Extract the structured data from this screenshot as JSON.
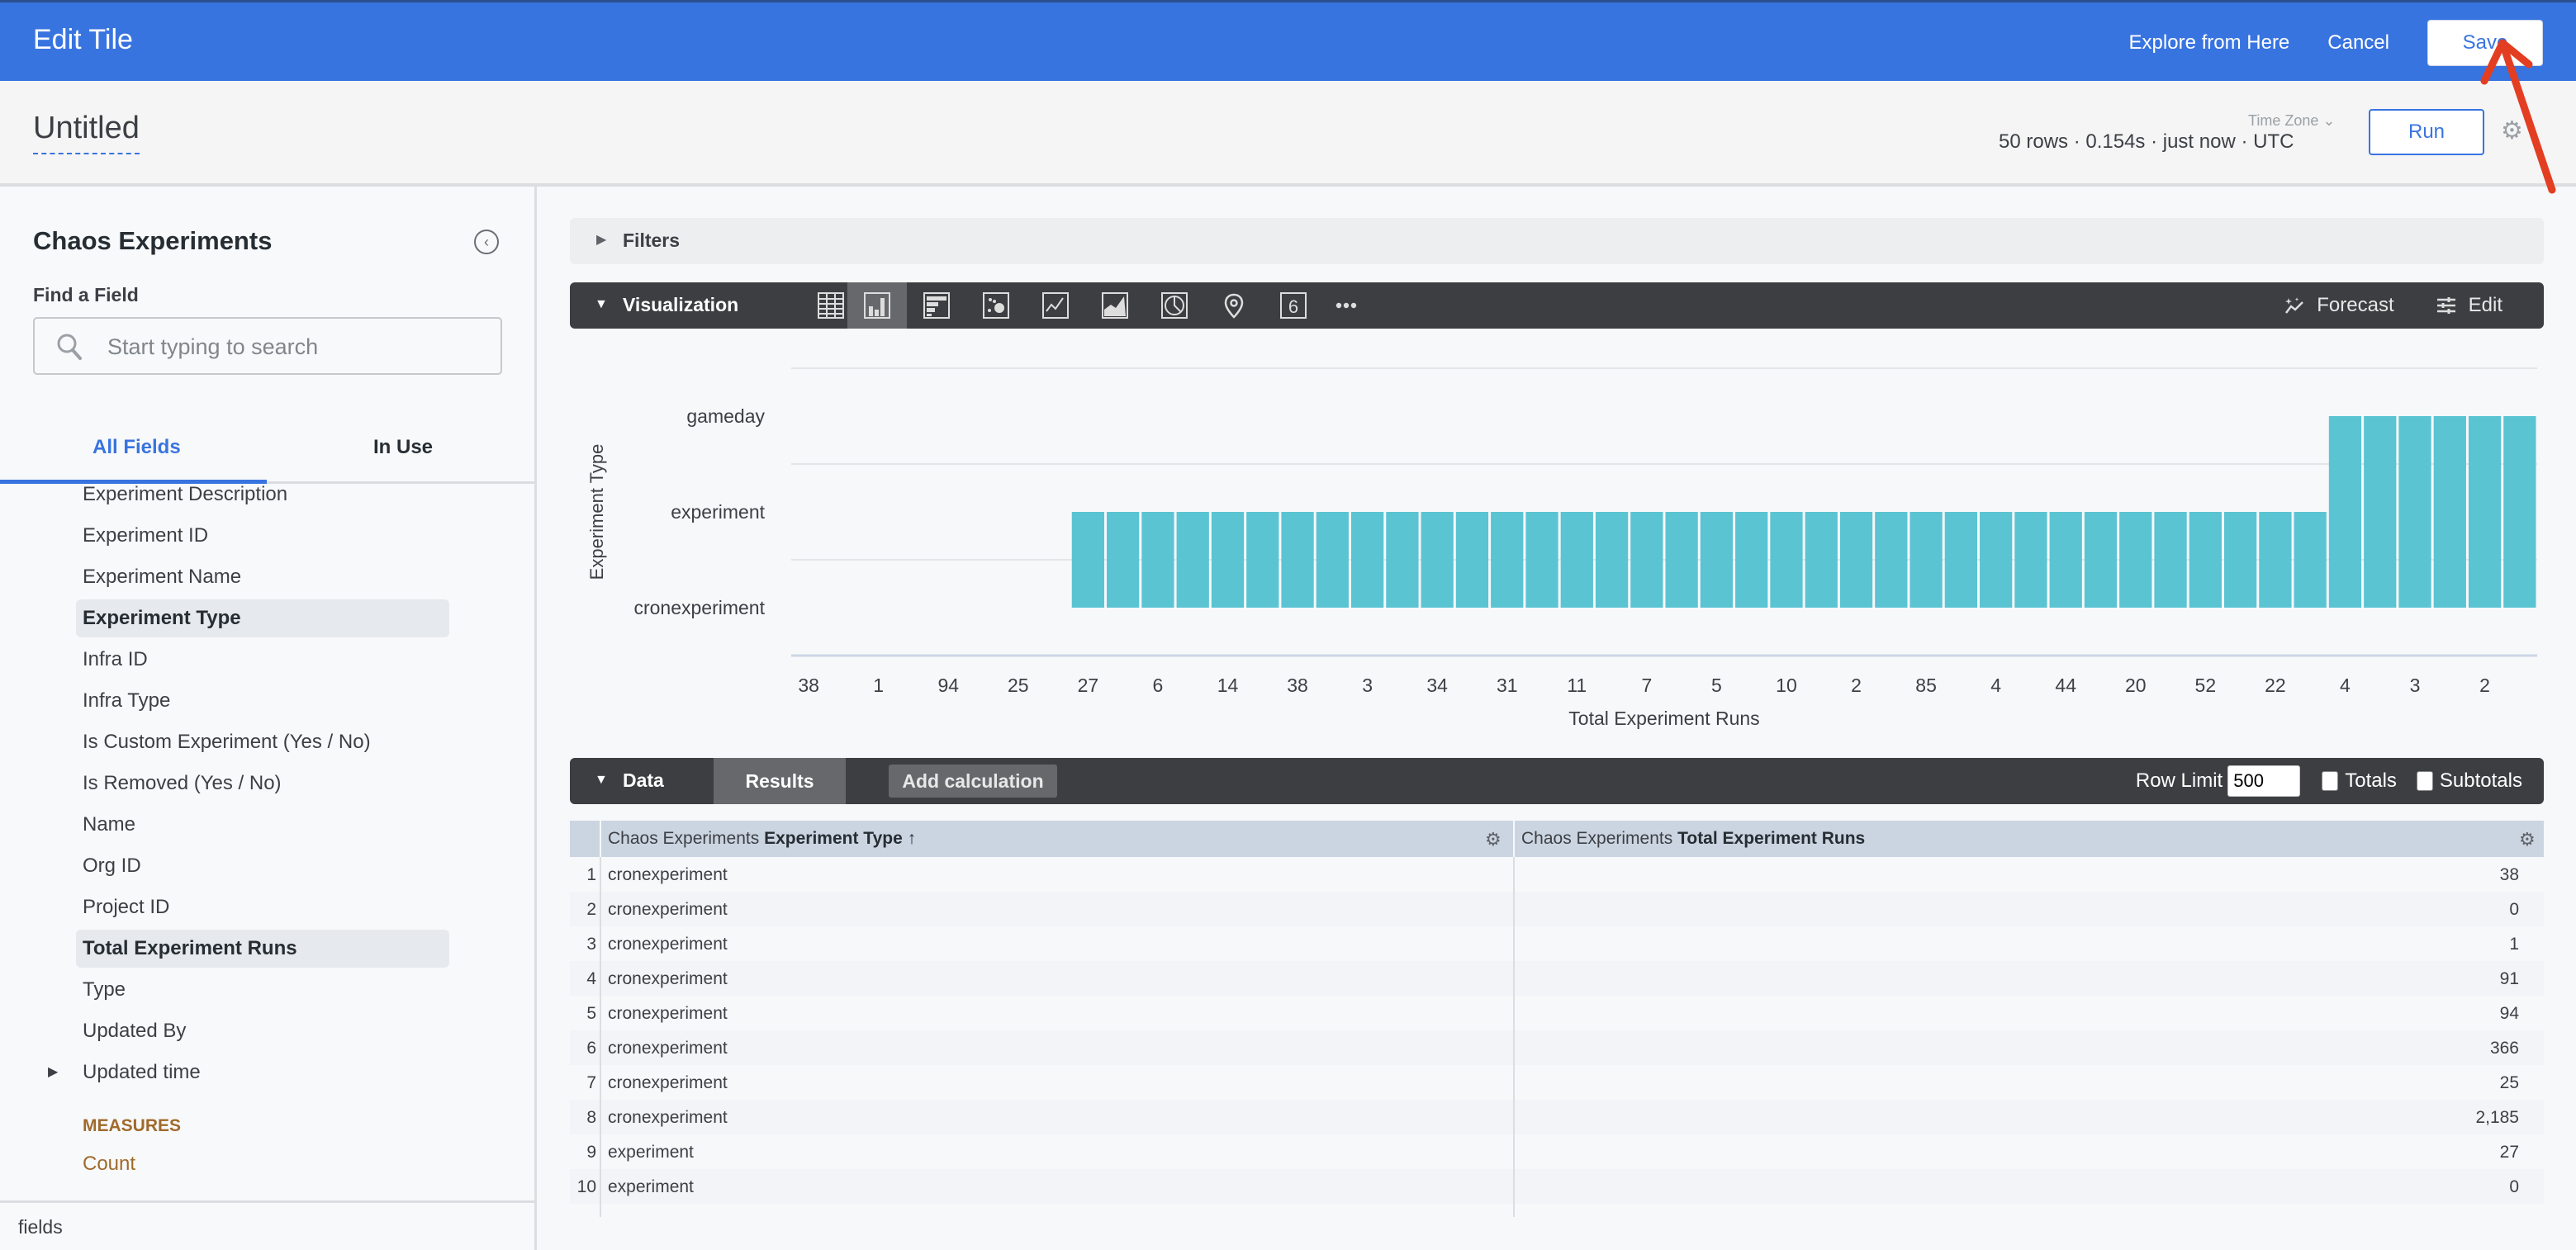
{
  "header": {
    "title": "Edit Tile",
    "explore_label": "Explore from Here",
    "cancel_label": "Cancel",
    "save_label": "Save"
  },
  "subheader": {
    "tile_title": "Untitled",
    "status": "50 rows · 0.154s · just now · UTC",
    "timezone_label": "Time Zone",
    "run_label": "Run"
  },
  "sidebar": {
    "explore_name": "Chaos Experiments",
    "find_label": "Find a Field",
    "search_placeholder": "Start typing to search",
    "tabs": [
      {
        "label": "All Fields",
        "active": true
      },
      {
        "label": "In Use",
        "active": false
      }
    ],
    "fields": [
      {
        "label": "Experiment Description",
        "selected": false
      },
      {
        "label": "Experiment ID",
        "selected": false
      },
      {
        "label": "Experiment Name",
        "selected": false
      },
      {
        "label": "Experiment Type",
        "selected": true
      },
      {
        "label": "Infra ID",
        "selected": false
      },
      {
        "label": "Infra Type",
        "selected": false
      },
      {
        "label": "Is Custom Experiment (Yes / No)",
        "selected": false
      },
      {
        "label": "Is Removed (Yes / No)",
        "selected": false
      },
      {
        "label": "Name",
        "selected": false
      },
      {
        "label": "Org ID",
        "selected": false
      },
      {
        "label": "Project ID",
        "selected": false
      },
      {
        "label": "Total Experiment Runs",
        "selected": true
      },
      {
        "label": "Type",
        "selected": false
      },
      {
        "label": "Updated By",
        "selected": false
      },
      {
        "label": "Updated time",
        "selected": false,
        "expandable": true
      }
    ],
    "measures_title": "MEASURES",
    "measures": [
      "Count"
    ],
    "footer": "fields"
  },
  "filters": {
    "label": "Filters"
  },
  "visualization": {
    "label": "Visualization",
    "types": [
      "table-icon",
      "column-chart-icon",
      "bar-chart-icon",
      "scatter-icon",
      "line-chart-icon",
      "area-chart-icon",
      "pie-chart-icon",
      "map-pin-icon",
      "single-value-icon",
      "more-icon"
    ],
    "active_type": "column-chart-icon",
    "forecast_label": "Forecast",
    "edit_label": "Edit"
  },
  "chart_data": {
    "type": "bar",
    "title": "",
    "xlabel": "Total Experiment Runs",
    "ylabel": "Experiment Type",
    "y_categories": [
      "cronexperiment",
      "experiment",
      "gameday"
    ],
    "x_tick_labels": [
      "38",
      "1",
      "94",
      "25",
      "27",
      "6",
      "14",
      "38",
      "3",
      "34",
      "31",
      "11",
      "7",
      "5",
      "10",
      "2",
      "85",
      "4",
      "44",
      "20",
      "52",
      "22",
      "4",
      "3",
      "2"
    ],
    "bar_count": 50,
    "series": [
      {
        "name": "Experiment Type",
        "values": [
          0,
          0,
          0,
          0,
          0,
          0,
          0,
          0,
          1,
          1,
          1,
          1,
          1,
          1,
          1,
          1,
          1,
          1,
          1,
          1,
          1,
          1,
          1,
          1,
          1,
          1,
          1,
          1,
          1,
          1,
          1,
          1,
          1,
          1,
          1,
          1,
          1,
          1,
          1,
          1,
          1,
          1,
          1,
          1,
          2,
          2,
          2,
          2,
          2,
          2
        ]
      }
    ],
    "value_meaning": "index into y_categories (0=cronexperiment, 1=experiment, 2=gameday)",
    "bar_color": "#5bc4d2",
    "grid": true
  },
  "data": {
    "label": "Data",
    "results_label": "Results",
    "add_calc_label": "Add calculation",
    "row_limit_label": "Row Limit",
    "row_limit": "500",
    "totals_label": "Totals",
    "subtotals_label": "Subtotals",
    "columns": [
      {
        "prefix": "Chaos Experiments",
        "name": "Experiment Type",
        "sort": "↑"
      },
      {
        "prefix": "Chaos Experiments",
        "name": "Total Experiment Runs",
        "sort": ""
      }
    ],
    "rows": [
      {
        "n": "1",
        "type": "cronexperiment",
        "value": "38"
      },
      {
        "n": "2",
        "type": "cronexperiment",
        "value": "0"
      },
      {
        "n": "3",
        "type": "cronexperiment",
        "value": "1"
      },
      {
        "n": "4",
        "type": "cronexperiment",
        "value": "91"
      },
      {
        "n": "5",
        "type": "cronexperiment",
        "value": "94"
      },
      {
        "n": "6",
        "type": "cronexperiment",
        "value": "366"
      },
      {
        "n": "7",
        "type": "cronexperiment",
        "value": "25"
      },
      {
        "n": "8",
        "type": "cronexperiment",
        "value": "2,185"
      },
      {
        "n": "9",
        "type": "experiment",
        "value": "27"
      },
      {
        "n": "10",
        "type": "experiment",
        "value": "0"
      }
    ]
  },
  "colors": {
    "brand": "#3874e0",
    "bar": "#5bc4d2",
    "toolbar": "#3d3e41",
    "measure": "#a06a2c"
  }
}
